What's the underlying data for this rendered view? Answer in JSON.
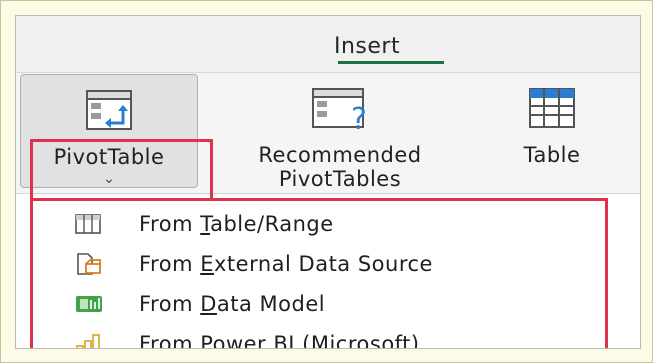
{
  "ribbon": {
    "tab": "Insert",
    "buttons": [
      {
        "label": "PivotTable",
        "chevron": "⌄",
        "icon": "pivottable-icon"
      },
      {
        "label_line1": "Recommended",
        "label_line2": "PivotTables",
        "icon": "recommended-pivottables-icon"
      },
      {
        "label": "Table",
        "icon": "table-icon"
      }
    ]
  },
  "menu": {
    "items": [
      {
        "prefix": "From ",
        "accel": "T",
        "rest": "able/Range",
        "icon": "table-range-icon"
      },
      {
        "prefix": "From ",
        "accel": "E",
        "rest": "xternal Data Source",
        "icon": "external-data-icon"
      },
      {
        "prefix": "From ",
        "accel": "D",
        "rest": "ata Model",
        "icon": "data-model-icon"
      },
      {
        "prefix": "From Power ",
        "accel": "BI",
        "rest": " (Microsoft)",
        "icon": "power-bi-icon"
      }
    ]
  },
  "colors": {
    "highlight": "#e0334a",
    "tab_underline": "#1e7145",
    "accent_blue": "#2b7cd3"
  }
}
